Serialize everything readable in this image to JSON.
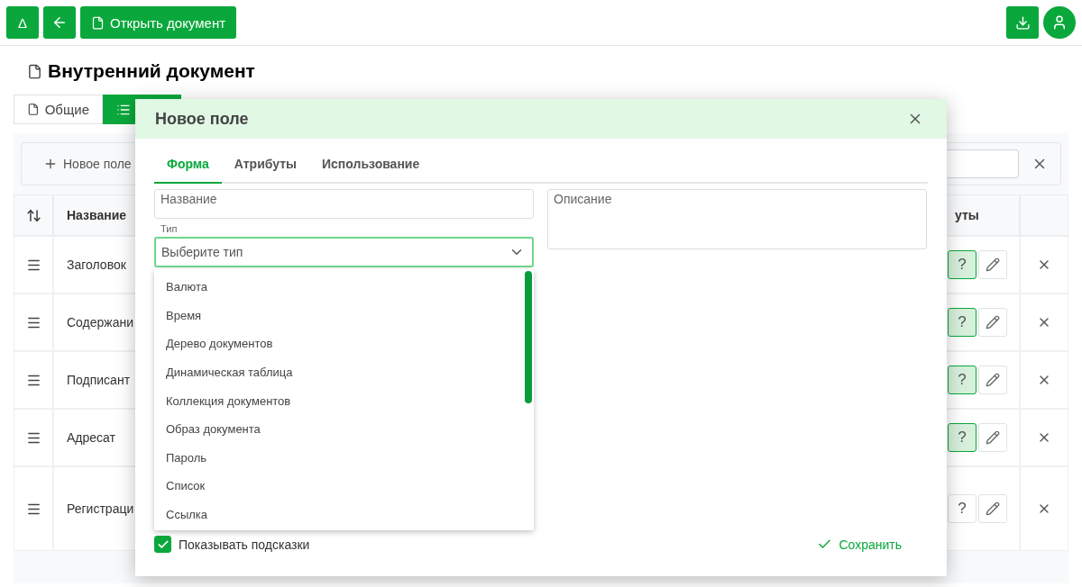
{
  "toolbar": {
    "buttons": [
      {
        "kind": "text",
        "label": "Δ"
      },
      {
        "kind": "back"
      },
      {
        "kind": "open",
        "label": "Открыть документ"
      }
    ],
    "right_buttons": [
      {
        "kind": "download"
      },
      {
        "kind": "user"
      }
    ]
  },
  "title": "Внутренний документ",
  "tabs": [
    {
      "label": "Общие",
      "kind": "general",
      "selected": false
    },
    {
      "kind": "list",
      "selected": true
    }
  ],
  "new_field_button": "Новое поле",
  "table": {
    "columns": [
      "Название",
      "уты"
    ],
    "rows": [
      {
        "name": "Заголовок",
        "hint_label": "?",
        "hint": true
      },
      {
        "name": "Содержани",
        "hint_label": "?",
        "hint": true
      },
      {
        "name": "Подписант",
        "hint_label": "?",
        "hint": true
      },
      {
        "name": "Адресат",
        "hint_label": "?",
        "hint": true
      },
      {
        "name": "Регистраци",
        "hint_label": "?",
        "hint": false
      }
    ]
  },
  "modal": {
    "title": "Новое поле",
    "tabs": [
      {
        "label": "Форма",
        "selected": true
      },
      {
        "label": "Атрибуты",
        "selected": false
      },
      {
        "label": "Использование",
        "selected": false
      }
    ],
    "name_field": {
      "placeholder": "Название"
    },
    "type_label": "Тип",
    "type_select": {
      "placeholder": "Выберите тип",
      "expanded": true,
      "options": [
        "Валюта",
        "Время",
        "Дерево документов",
        "Динамическая таблица",
        "Коллекция документов",
        "Образ документа",
        "Пароль",
        "Список",
        "Ссылка"
      ]
    },
    "description_field": {
      "placeholder": "Описание"
    },
    "show_hints": {
      "label": "Показывать подсказки",
      "checked": true
    },
    "save_button": "Сохранить"
  }
}
